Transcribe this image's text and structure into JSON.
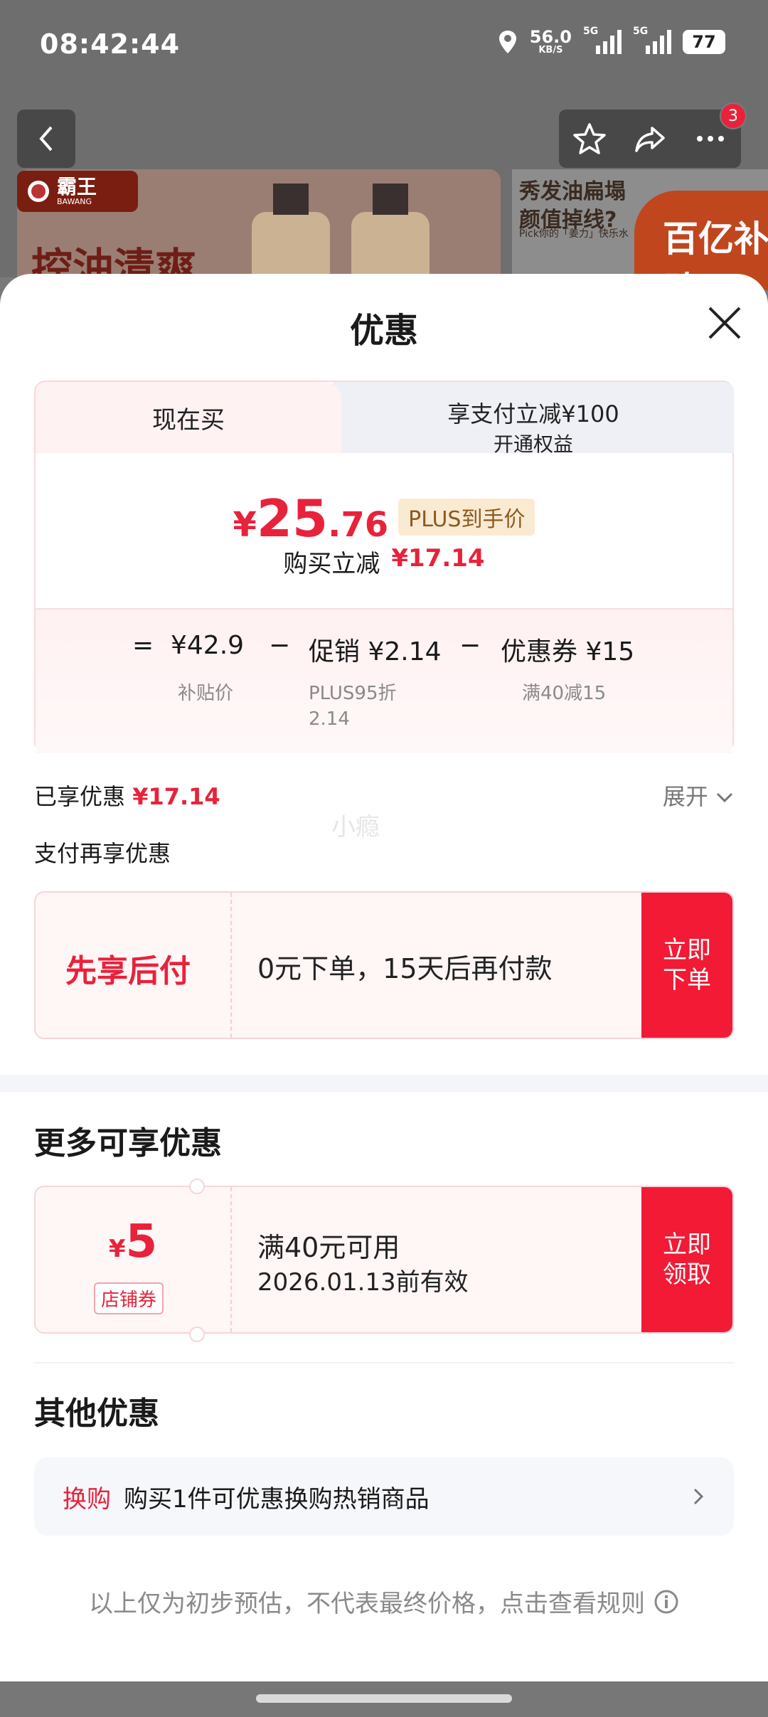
{
  "status_bar": {
    "time": "08:42:44",
    "net_speed": "56.0",
    "net_unit": "KB/S",
    "sim1": "5G",
    "sim2": "5G",
    "battery": "77"
  },
  "nav": {
    "cart_count": "3"
  },
  "banner": {
    "brand_name": "霸王",
    "brand_sub": "BAWANG",
    "headline": "控油清爽",
    "promo_line1": "秀发油扁塌",
    "promo_line2": "颜值掉线?",
    "promo_small": "Pick你的「姜力」快乐水",
    "subsidy": "百亿补贴"
  },
  "sheet": {
    "title": "优惠",
    "tabs": {
      "current": "现在买",
      "pay_line1": "享支付立减¥100",
      "pay_line2": "开通权益"
    },
    "price": {
      "symbol": "¥",
      "integer": "25",
      "decimal": ".76",
      "tag": "PLUS到手价"
    },
    "reduce": {
      "label": "购买立减",
      "value": "¥17.14"
    },
    "calc": {
      "eq": "=",
      "base": "¥42.9",
      "base_sub": "补贴价",
      "minus1": "−",
      "promo": "促销 ¥2.14",
      "promo_sub1": "PLUS95折",
      "promo_sub2": "2.14",
      "minus2": "−",
      "coupon": "优惠券 ¥15",
      "coupon_sub": "满40减15"
    },
    "enjoyed": {
      "label": "已享优惠",
      "value": "¥17.14",
      "expand": "展开"
    },
    "watermark": "小瘾",
    "pay_again": "支付再享优惠",
    "bnpl": {
      "label": "先享后付",
      "desc": "0元下单，15天后再付款",
      "button_l1": "立即",
      "button_l2": "下单"
    },
    "more": {
      "title": "更多可享优惠",
      "coupon": {
        "symbol": "¥",
        "amount": "5",
        "type": "店铺券",
        "condition": "满40元可用",
        "expiry": "2026.01.13前有效",
        "button_l1": "立即",
        "button_l2": "领取"
      }
    },
    "other": {
      "title": "其他优惠",
      "tag": "换购",
      "desc": "购买1件可优惠换购热销商品"
    },
    "disclaimer": "以上仅为初步预估，不代表最终价格，点击查看规则"
  }
}
